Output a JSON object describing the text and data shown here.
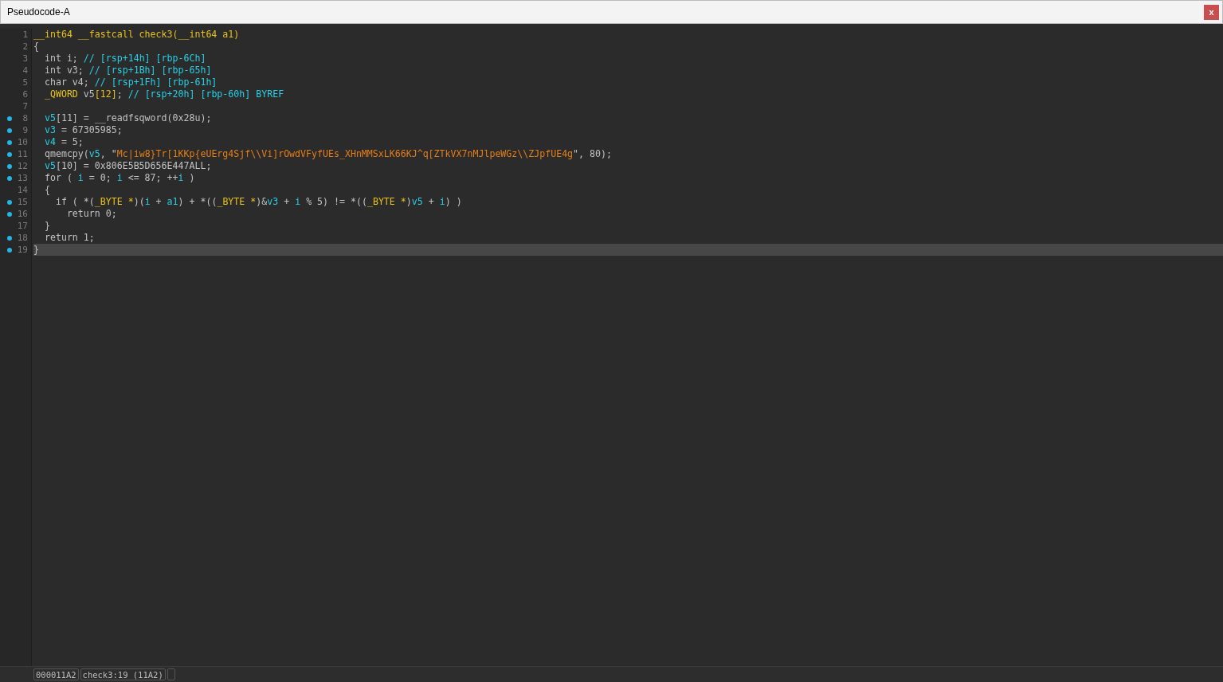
{
  "window": {
    "title": "Pseudocode-A",
    "close_label": "x"
  },
  "code_lines": [
    {
      "number": "1",
      "breakpoint": false,
      "current": false,
      "tokens": [
        {
          "text": "__int64 __fastcall check3(__int64 a1)",
          "kind": "type"
        }
      ]
    },
    {
      "number": "2",
      "breakpoint": false,
      "current": false,
      "tokens": [
        {
          "text": "{",
          "kind": "plain"
        }
      ]
    },
    {
      "number": "3",
      "breakpoint": false,
      "current": false,
      "tokens": [
        {
          "text": "  int i; ",
          "kind": "plain"
        },
        {
          "text": "// [rsp+14h] [rbp-6Ch]",
          "kind": "comment"
        }
      ]
    },
    {
      "number": "4",
      "breakpoint": false,
      "current": false,
      "tokens": [
        {
          "text": "  int v3; ",
          "kind": "plain"
        },
        {
          "text": "// [rsp+1Bh] [rbp-65h]",
          "kind": "comment"
        }
      ]
    },
    {
      "number": "5",
      "breakpoint": false,
      "current": false,
      "tokens": [
        {
          "text": "  char v4; ",
          "kind": "plain"
        },
        {
          "text": "// [rsp+1Fh] [rbp-61h]",
          "kind": "comment"
        }
      ]
    },
    {
      "number": "6",
      "breakpoint": false,
      "current": false,
      "tokens": [
        {
          "text": "  _QWORD",
          "kind": "type"
        },
        {
          "text": " v5",
          "kind": "plain"
        },
        {
          "text": "[12]",
          "kind": "type"
        },
        {
          "text": "; ",
          "kind": "plain"
        },
        {
          "text": "// [rsp+20h] [rbp-60h] BYREF",
          "kind": "comment"
        }
      ]
    },
    {
      "number": "7",
      "breakpoint": false,
      "current": false
    },
    {
      "number": "8",
      "breakpoint": true,
      "current": false,
      "tokens": [
        {
          "text": "  v5",
          "kind": "var"
        },
        {
          "text": "[11] = __readfsqword(0x28u);",
          "kind": "plain"
        }
      ]
    },
    {
      "number": "9",
      "breakpoint": true,
      "current": false,
      "tokens": [
        {
          "text": "  v3",
          "kind": "var"
        },
        {
          "text": " = 67305985;",
          "kind": "plain"
        }
      ]
    },
    {
      "number": "10",
      "breakpoint": true,
      "current": false,
      "tokens": [
        {
          "text": "  v4",
          "kind": "var"
        },
        {
          "text": " = 5;",
          "kind": "plain"
        }
      ]
    },
    {
      "number": "11",
      "breakpoint": true,
      "current": false,
      "tokens": [
        {
          "text": "  qmemcpy(",
          "kind": "plain"
        },
        {
          "text": "v5",
          "kind": "var"
        },
        {
          "text": ", \"",
          "kind": "plain"
        },
        {
          "text": "Mc|iw8}Tr[1KKp{eUErg4Sjf\\\\Vi]rOwdVFyfUEs_XHnMMSxLK66KJ^q[ZTkVX7nMJlpeWGz\\\\ZJpfUE4g",
          "kind": "string"
        },
        {
          "text": "\", 80);",
          "kind": "plain"
        }
      ]
    },
    {
      "number": "12",
      "breakpoint": true,
      "current": false,
      "tokens": [
        {
          "text": "  v5",
          "kind": "var"
        },
        {
          "text": "[10] = 0x806E5B5D656E447ALL;",
          "kind": "plain"
        }
      ]
    },
    {
      "number": "13",
      "breakpoint": true,
      "current": false,
      "tokens": [
        {
          "text": "  for ( ",
          "kind": "plain"
        },
        {
          "text": "i",
          "kind": "var"
        },
        {
          "text": " = 0; ",
          "kind": "plain"
        },
        {
          "text": "i",
          "kind": "var"
        },
        {
          "text": " <= 87; ++",
          "kind": "plain"
        },
        {
          "text": "i",
          "kind": "var"
        },
        {
          "text": " )",
          "kind": "plain"
        }
      ]
    },
    {
      "number": "14",
      "breakpoint": false,
      "current": false,
      "tokens": [
        {
          "text": "  {",
          "kind": "plain"
        }
      ]
    },
    {
      "number": "15",
      "breakpoint": true,
      "current": false,
      "tokens": [
        {
          "text": "    if ( *(",
          "kind": "plain"
        },
        {
          "text": "_BYTE *",
          "kind": "type"
        },
        {
          "text": ")(",
          "kind": "plain"
        },
        {
          "text": "i",
          "kind": "var"
        },
        {
          "text": " + ",
          "kind": "plain"
        },
        {
          "text": "a1",
          "kind": "var"
        },
        {
          "text": ") + *((",
          "kind": "plain"
        },
        {
          "text": "_BYTE *",
          "kind": "type"
        },
        {
          "text": ")&",
          "kind": "plain"
        },
        {
          "text": "v3",
          "kind": "var"
        },
        {
          "text": " + ",
          "kind": "plain"
        },
        {
          "text": "i",
          "kind": "var"
        },
        {
          "text": " % 5) != *((",
          "kind": "plain"
        },
        {
          "text": "_BYTE *",
          "kind": "type"
        },
        {
          "text": ")",
          "kind": "plain"
        },
        {
          "text": "v5",
          "kind": "var"
        },
        {
          "text": " + ",
          "kind": "plain"
        },
        {
          "text": "i",
          "kind": "var"
        },
        {
          "text": ") )",
          "kind": "plain"
        }
      ]
    },
    {
      "number": "16",
      "breakpoint": true,
      "current": false,
      "tokens": [
        {
          "text": "      return 0;",
          "kind": "plain"
        }
      ]
    },
    {
      "number": "17",
      "breakpoint": false,
      "current": false,
      "tokens": [
        {
          "text": "  }",
          "kind": "plain"
        }
      ]
    },
    {
      "number": "18",
      "breakpoint": true,
      "current": false,
      "tokens": [
        {
          "text": "  return 1;",
          "kind": "plain"
        }
      ]
    },
    {
      "number": "19",
      "breakpoint": true,
      "current": true,
      "tokens": [
        {
          "text": "}",
          "kind": "plain"
        }
      ]
    }
  ],
  "status_bar": {
    "address": "000011A2",
    "location": "check3:19 (11A2)"
  }
}
